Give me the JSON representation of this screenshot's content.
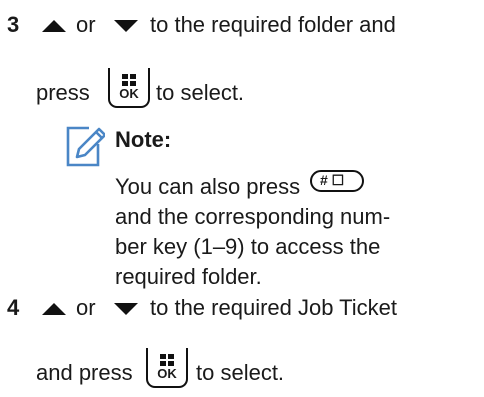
{
  "steps": [
    {
      "number": "3",
      "connector": "or",
      "line1_rest": "to the required folder and",
      "line2_prefix": "press",
      "line2_suffix": "to select.",
      "note": {
        "label": "Note:",
        "line1_prefix": "You can also press",
        "line2": "and the corresponding num-",
        "line3": "ber key (1–9) to access the",
        "line4": "required folder."
      }
    },
    {
      "number": "4",
      "connector": "or",
      "line1_rest": "to the required Job Ticket",
      "line2_prefix": "and press",
      "line2_suffix": "to select."
    }
  ],
  "keys": {
    "ok_label": "OK",
    "hash_label": "# ☐"
  },
  "icons": {
    "up": "up-arrow-icon",
    "down": "down-arrow-icon",
    "ok_key": "menu-ok-key-icon",
    "hash_key": "hash-key-icon",
    "note": "note-pencil-icon"
  }
}
